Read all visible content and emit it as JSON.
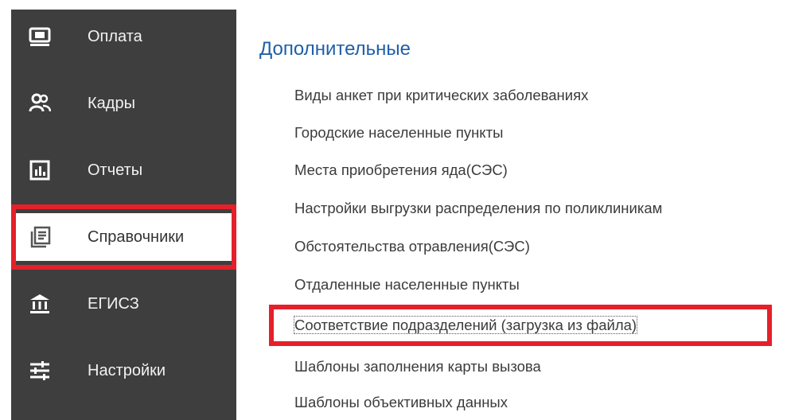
{
  "colors": {
    "sidebar_bg": "#3e3e3e",
    "highlight": "#e5202a",
    "section_title": "#1f5fa8",
    "item_text": "#3b3b3b"
  },
  "sidebar": {
    "items": [
      {
        "label": "Оплата",
        "icon": "payment-icon"
      },
      {
        "label": "Кадры",
        "icon": "people-icon"
      },
      {
        "label": "Отчеты",
        "icon": "chart-icon"
      },
      {
        "label": "Справочники",
        "icon": "directory-icon",
        "active": true
      },
      {
        "label": "ЕГИСЗ",
        "icon": "institution-icon"
      },
      {
        "label": "Настройки",
        "icon": "sliders-icon"
      }
    ]
  },
  "main": {
    "section_title": "Дополнительные",
    "items": [
      "Виды анкет при критических заболеваниях",
      "Городские населенные пункты",
      "Места приобретения яда(СЭС)",
      "Настройки выгрузки распределения по поликлиникам",
      "Обстоятельства отравления(СЭС)",
      "Отдаленные населенные пункты",
      "Соответствие подразделений (загрузка из файла)",
      "Шаблоны заполнения карты вызова",
      "Шаблоны объективных данных"
    ]
  }
}
